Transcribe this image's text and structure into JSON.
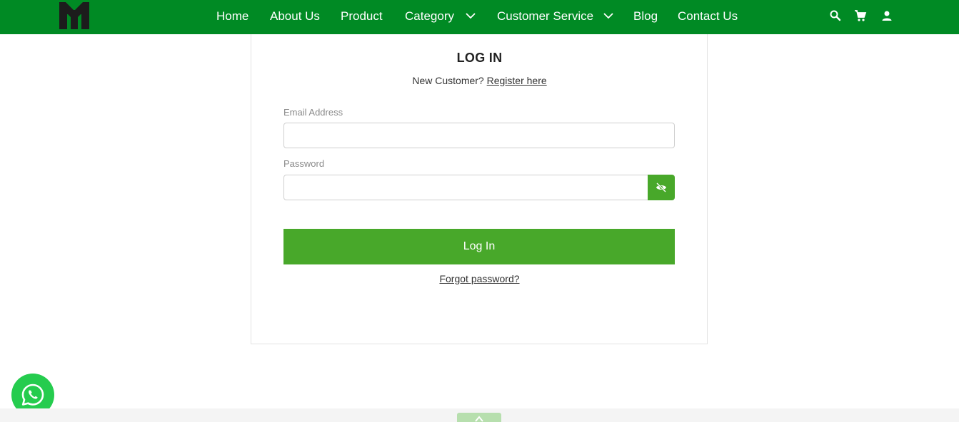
{
  "header": {
    "logo": "site-logo",
    "nav": [
      {
        "label": "Home"
      },
      {
        "label": "About Us"
      },
      {
        "label": "Product"
      },
      {
        "label": "Category",
        "has_dropdown": true
      },
      {
        "label": "Customer Service",
        "has_dropdown": true
      },
      {
        "label": "Blog"
      },
      {
        "label": "Contact Us"
      }
    ],
    "icons": [
      "search-icon",
      "cart-icon",
      "user-icon"
    ],
    "background": "#008a24"
  },
  "login": {
    "title": "LOG IN",
    "new_customer_text": "New Customer?",
    "register_link": "Register here",
    "email_label": "Email Address",
    "email_value": "",
    "password_label": "Password",
    "password_value": "",
    "toggle_icon": "eye-off-icon",
    "submit_label": "Log In",
    "forgot_link": "Forgot password?",
    "accent": "#48a82a"
  },
  "floating": {
    "whatsapp_icon": "whatsapp-icon",
    "whatsapp_color": "#25cc4e",
    "scroll_top_icon": "arrow-up-icon"
  }
}
